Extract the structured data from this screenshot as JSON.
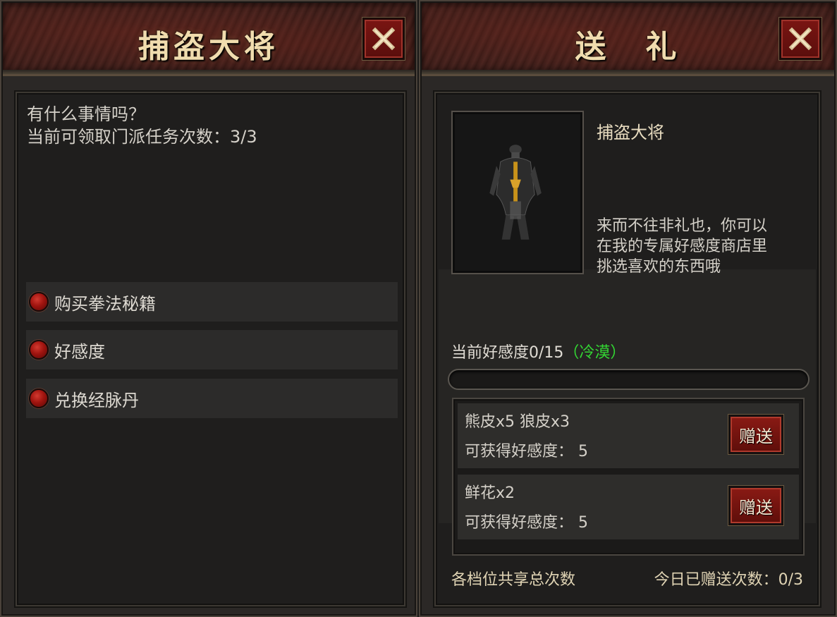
{
  "left_panel": {
    "title": "捕盗大将",
    "dialog": "有什么事情吗？\n当前可领取门派任务次数：3/3",
    "options": [
      {
        "label": "购买拳法秘籍"
      },
      {
        "label": "好感度"
      },
      {
        "label": "兑换经脉丹"
      }
    ]
  },
  "right_panel": {
    "title": "送　礼",
    "npc_name": "捕盗大将",
    "npc_desc": "来而不往非礼也，你可以\n在我的专属好感度商店里\n挑选喜欢的东西哦",
    "favor_label": "当前好感度0/15",
    "favor_status": "（冷漠）",
    "favor_progress": 0,
    "gifts": [
      {
        "name": "熊皮x5 狼皮x3",
        "reward": "可获得好感度： 5",
        "button": "赠送"
      },
      {
        "name": "鲜花x2",
        "reward": "可获得好感度： 5",
        "button": "赠送"
      }
    ],
    "footer_left": "各档位共享总次数",
    "footer_right": "今日已赠送次数：0/3"
  },
  "colors": {
    "title": "#f0dcae",
    "favor_status": "#33d633",
    "button_red": "#8a1a14"
  }
}
